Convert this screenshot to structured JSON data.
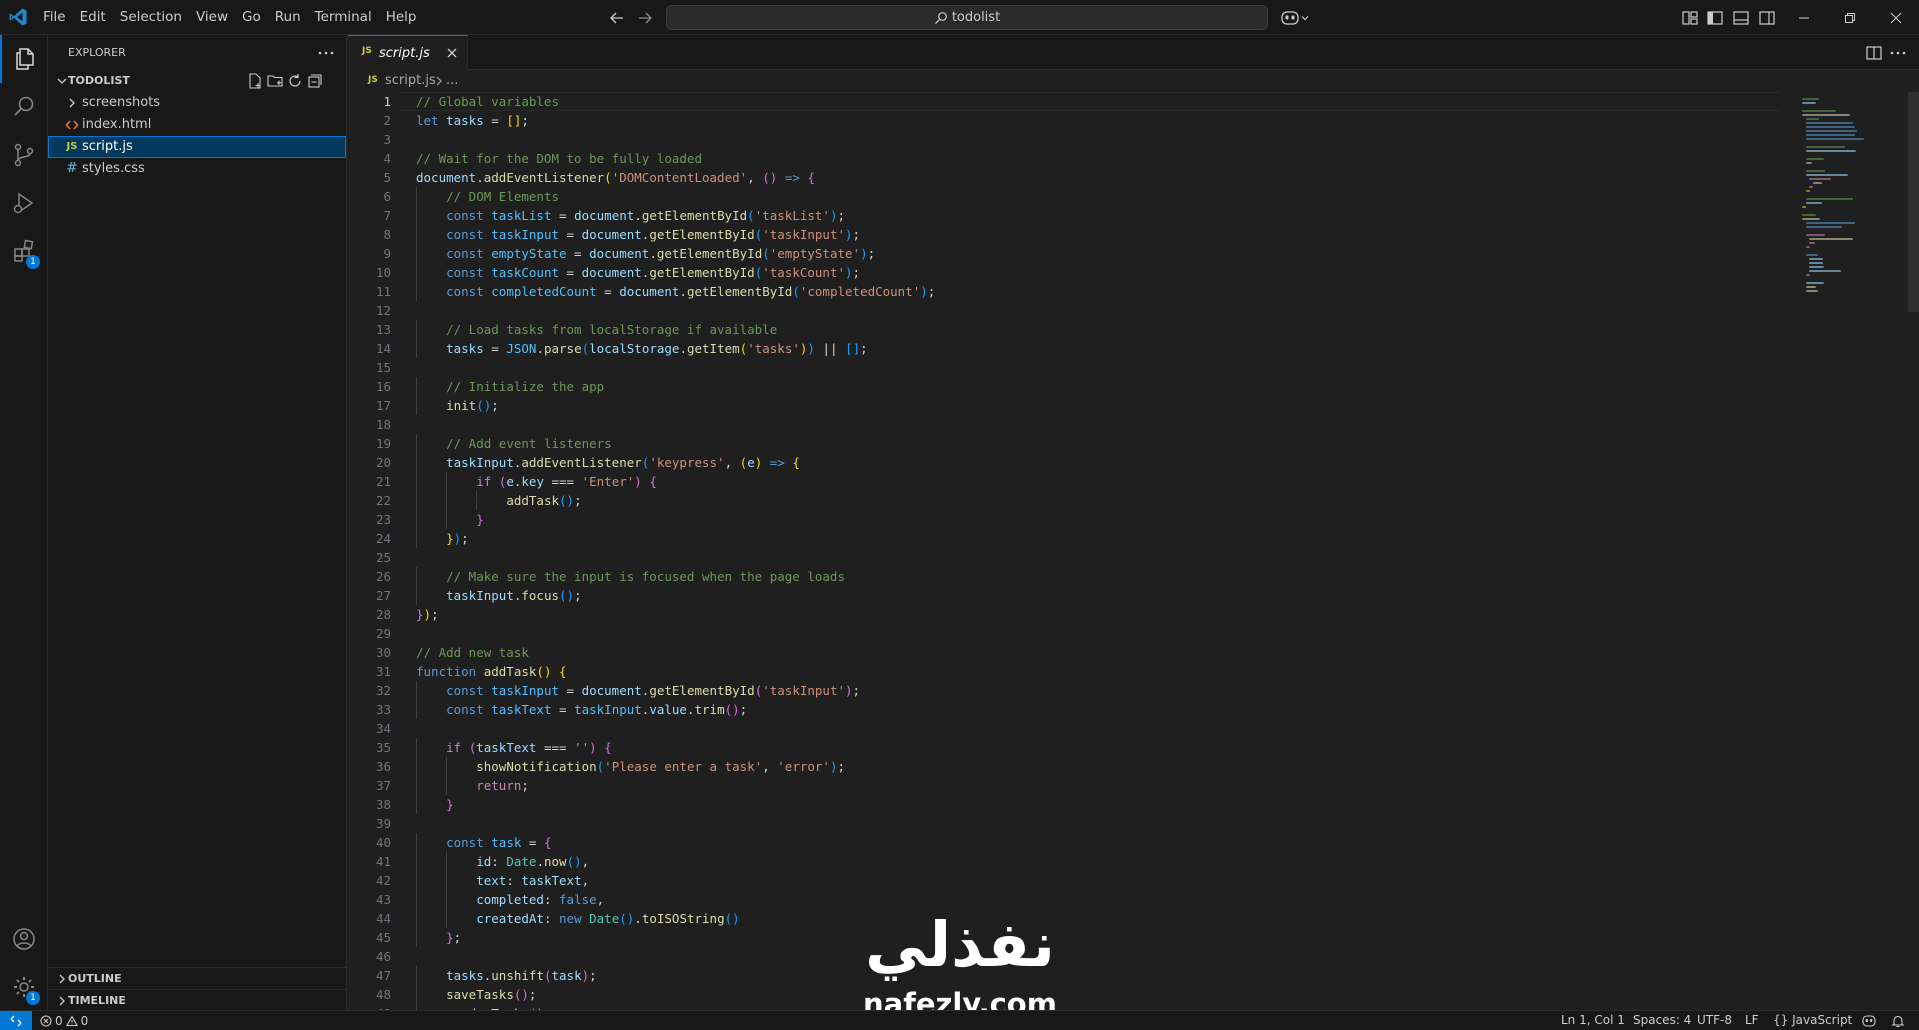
{
  "menu": [
    "File",
    "Edit",
    "Selection",
    "View",
    "Go",
    "Run",
    "Terminal",
    "Help"
  ],
  "search": {
    "text": "todolist"
  },
  "sidebar": {
    "title": "EXPLORER",
    "folder": "TODOLIST",
    "items": [
      {
        "label": "screenshots",
        "kind": "folder"
      },
      {
        "label": "index.html",
        "kind": "html"
      },
      {
        "label": "script.js",
        "kind": "js"
      },
      {
        "label": "styles.css",
        "kind": "css"
      }
    ],
    "icon_text": {
      "js": "JS",
      "css": "#"
    },
    "outline": "OUTLINE",
    "timeline": "TIMELINE"
  },
  "activity": {
    "extensions_badge": "1",
    "manage_badge": "1"
  },
  "tab": {
    "label": "script.js",
    "icon": "JS"
  },
  "breadcrumb": {
    "file": "script.js",
    "more": "..."
  },
  "code": {
    "lines": [
      [
        [
          "c",
          "// Global variables"
        ]
      ],
      [
        [
          "k",
          "let "
        ],
        [
          "v",
          "tasks"
        ],
        [
          "p",
          " = "
        ],
        [
          "b1",
          "[]"
        ],
        [
          "p",
          ";"
        ]
      ],
      [],
      [
        [
          "c",
          "// Wait for the DOM to be fully loaded"
        ]
      ],
      [
        [
          "v",
          "document"
        ],
        [
          "p",
          "."
        ],
        [
          "f",
          "addEventListener"
        ],
        [
          "b1",
          "("
        ],
        [
          "s",
          "'DOMContentLoaded'"
        ],
        [
          "p",
          ", "
        ],
        [
          "b2",
          "()"
        ],
        [
          "k",
          " => "
        ],
        [
          "b2",
          "{"
        ]
      ],
      [
        [
          "p",
          "    "
        ],
        [
          "c",
          "// DOM Elements"
        ]
      ],
      [
        [
          "p",
          "    "
        ],
        [
          "k",
          "const "
        ],
        [
          "vc",
          "taskList"
        ],
        [
          "p",
          " = "
        ],
        [
          "v",
          "document"
        ],
        [
          "p",
          "."
        ],
        [
          "f",
          "getElementById"
        ],
        [
          "b3",
          "("
        ],
        [
          "s",
          "'taskList'"
        ],
        [
          "b3",
          ")"
        ],
        [
          "p",
          ";"
        ]
      ],
      [
        [
          "p",
          "    "
        ],
        [
          "k",
          "const "
        ],
        [
          "vc",
          "taskInput"
        ],
        [
          "p",
          " = "
        ],
        [
          "v",
          "document"
        ],
        [
          "p",
          "."
        ],
        [
          "f",
          "getElementById"
        ],
        [
          "b3",
          "("
        ],
        [
          "s",
          "'taskInput'"
        ],
        [
          "b3",
          ")"
        ],
        [
          "p",
          ";"
        ]
      ],
      [
        [
          "p",
          "    "
        ],
        [
          "k",
          "const "
        ],
        [
          "vc",
          "emptyState"
        ],
        [
          "p",
          " = "
        ],
        [
          "v",
          "document"
        ],
        [
          "p",
          "."
        ],
        [
          "f",
          "getElementById"
        ],
        [
          "b3",
          "("
        ],
        [
          "s",
          "'emptyState'"
        ],
        [
          "b3",
          ")"
        ],
        [
          "p",
          ";"
        ]
      ],
      [
        [
          "p",
          "    "
        ],
        [
          "k",
          "const "
        ],
        [
          "vc",
          "taskCount"
        ],
        [
          "p",
          " = "
        ],
        [
          "v",
          "document"
        ],
        [
          "p",
          "."
        ],
        [
          "f",
          "getElementById"
        ],
        [
          "b3",
          "("
        ],
        [
          "s",
          "'taskCount'"
        ],
        [
          "b3",
          ")"
        ],
        [
          "p",
          ";"
        ]
      ],
      [
        [
          "p",
          "    "
        ],
        [
          "k",
          "const "
        ],
        [
          "vc",
          "completedCount"
        ],
        [
          "p",
          " = "
        ],
        [
          "v",
          "document"
        ],
        [
          "p",
          "."
        ],
        [
          "f",
          "getElementById"
        ],
        [
          "b3",
          "("
        ],
        [
          "s",
          "'completedCount'"
        ],
        [
          "b3",
          ")"
        ],
        [
          "p",
          ";"
        ]
      ],
      [],
      [
        [
          "p",
          "    "
        ],
        [
          "c",
          "// Load tasks from localStorage if available"
        ]
      ],
      [
        [
          "p",
          "    "
        ],
        [
          "v",
          "tasks"
        ],
        [
          "p",
          " = "
        ],
        [
          "vc",
          "JSON"
        ],
        [
          "p",
          "."
        ],
        [
          "f",
          "parse"
        ],
        [
          "b3",
          "("
        ],
        [
          "v",
          "localStorage"
        ],
        [
          "p",
          "."
        ],
        [
          "f",
          "getItem"
        ],
        [
          "b1",
          "("
        ],
        [
          "s",
          "'tasks'"
        ],
        [
          "b1",
          ")"
        ],
        [
          "b3",
          ")"
        ],
        [
          "p",
          " || "
        ],
        [
          "b3",
          "[]"
        ],
        [
          "p",
          ";"
        ]
      ],
      [],
      [
        [
          "p",
          "    "
        ],
        [
          "c",
          "// Initialize the app"
        ]
      ],
      [
        [
          "p",
          "    "
        ],
        [
          "f",
          "init"
        ],
        [
          "b3",
          "()"
        ],
        [
          "p",
          ";"
        ]
      ],
      [],
      [
        [
          "p",
          "    "
        ],
        [
          "c",
          "// Add event listeners"
        ]
      ],
      [
        [
          "p",
          "    "
        ],
        [
          "v",
          "taskInput"
        ],
        [
          "p",
          "."
        ],
        [
          "f",
          "addEventListener"
        ],
        [
          "b3",
          "("
        ],
        [
          "s",
          "'keypress'"
        ],
        [
          "p",
          ", "
        ],
        [
          "b1",
          "("
        ],
        [
          "v",
          "e"
        ],
        [
          "b1",
          ")"
        ],
        [
          "k",
          " => "
        ],
        [
          "b1",
          "{"
        ]
      ],
      [
        [
          "p",
          "        "
        ],
        [
          "kc",
          "if "
        ],
        [
          "b2",
          "("
        ],
        [
          "v",
          "e"
        ],
        [
          "p",
          "."
        ],
        [
          "v",
          "key"
        ],
        [
          "p",
          " === "
        ],
        [
          "s",
          "'Enter'"
        ],
        [
          "b2",
          ")"
        ],
        [
          "p",
          " "
        ],
        [
          "b2",
          "{"
        ]
      ],
      [
        [
          "p",
          "            "
        ],
        [
          "f",
          "addTask"
        ],
        [
          "b3",
          "()"
        ],
        [
          "p",
          ";"
        ]
      ],
      [
        [
          "p",
          "        "
        ],
        [
          "b2",
          "}"
        ]
      ],
      [
        [
          "p",
          "    "
        ],
        [
          "b1",
          "}"
        ],
        [
          "b3",
          ")"
        ],
        [
          "p",
          ";"
        ]
      ],
      [],
      [
        [
          "p",
          "    "
        ],
        [
          "c",
          "// Make sure the input is focused when the page loads"
        ]
      ],
      [
        [
          "p",
          "    "
        ],
        [
          "v",
          "taskInput"
        ],
        [
          "p",
          "."
        ],
        [
          "f",
          "focus"
        ],
        [
          "b3",
          "()"
        ],
        [
          "p",
          ";"
        ]
      ],
      [
        [
          "b2",
          "}"
        ],
        [
          "b1",
          ")"
        ],
        [
          "p",
          ";"
        ]
      ],
      [],
      [
        [
          "c",
          "// Add new task"
        ]
      ],
      [
        [
          "k",
          "function "
        ],
        [
          "f",
          "addTask"
        ],
        [
          "b1",
          "()"
        ],
        [
          "p",
          " "
        ],
        [
          "b1",
          "{"
        ]
      ],
      [
        [
          "p",
          "    "
        ],
        [
          "k",
          "const "
        ],
        [
          "vc",
          "taskInput"
        ],
        [
          "p",
          " = "
        ],
        [
          "v",
          "document"
        ],
        [
          "p",
          "."
        ],
        [
          "f",
          "getElementById"
        ],
        [
          "b2",
          "("
        ],
        [
          "s",
          "'taskInput'"
        ],
        [
          "b2",
          ")"
        ],
        [
          "p",
          ";"
        ]
      ],
      [
        [
          "p",
          "    "
        ],
        [
          "k",
          "const "
        ],
        [
          "vc",
          "taskText"
        ],
        [
          "p",
          " = "
        ],
        [
          "vc",
          "taskInput"
        ],
        [
          "p",
          "."
        ],
        [
          "v",
          "value"
        ],
        [
          "p",
          "."
        ],
        [
          "f",
          "trim"
        ],
        [
          "b2",
          "()"
        ],
        [
          "p",
          ";"
        ]
      ],
      [],
      [
        [
          "p",
          "    "
        ],
        [
          "kc",
          "if "
        ],
        [
          "b2",
          "("
        ],
        [
          "v",
          "taskText"
        ],
        [
          "p",
          " === "
        ],
        [
          "s",
          "''"
        ],
        [
          "b2",
          ")"
        ],
        [
          "p",
          " "
        ],
        [
          "b2",
          "{"
        ]
      ],
      [
        [
          "p",
          "        "
        ],
        [
          "f",
          "showNotification"
        ],
        [
          "b3",
          "("
        ],
        [
          "s",
          "'Please enter a task'"
        ],
        [
          "p",
          ", "
        ],
        [
          "s",
          "'error'"
        ],
        [
          "b3",
          ")"
        ],
        [
          "p",
          ";"
        ]
      ],
      [
        [
          "p",
          "        "
        ],
        [
          "kc",
          "return"
        ],
        [
          "p",
          ";"
        ]
      ],
      [
        [
          "p",
          "    "
        ],
        [
          "b2",
          "}"
        ]
      ],
      [],
      [
        [
          "p",
          "    "
        ],
        [
          "k",
          "const "
        ],
        [
          "vc",
          "task"
        ],
        [
          "p",
          " = "
        ],
        [
          "b2",
          "{"
        ]
      ],
      [
        [
          "p",
          "        "
        ],
        [
          "v",
          "id"
        ],
        [
          "p",
          ": "
        ],
        [
          "t",
          "Date"
        ],
        [
          "p",
          "."
        ],
        [
          "f",
          "now"
        ],
        [
          "b3",
          "()"
        ],
        [
          "p",
          ","
        ]
      ],
      [
        [
          "p",
          "        "
        ],
        [
          "v",
          "text"
        ],
        [
          "p",
          ": "
        ],
        [
          "v",
          "taskText"
        ],
        [
          "p",
          ","
        ]
      ],
      [
        [
          "p",
          "        "
        ],
        [
          "v",
          "completed"
        ],
        [
          "p",
          ": "
        ],
        [
          "k",
          "false"
        ],
        [
          "p",
          ","
        ]
      ],
      [
        [
          "p",
          "        "
        ],
        [
          "v",
          "createdAt"
        ],
        [
          "p",
          ": "
        ],
        [
          "k",
          "new "
        ],
        [
          "t",
          "Date"
        ],
        [
          "b3",
          "()"
        ],
        [
          "p",
          "."
        ],
        [
          "f",
          "toISOString"
        ],
        [
          "b3",
          "()"
        ]
      ],
      [
        [
          "p",
          "    "
        ],
        [
          "b2",
          "}"
        ],
        [
          "p",
          ";"
        ]
      ],
      [],
      [
        [
          "p",
          "    "
        ],
        [
          "v",
          "tasks"
        ],
        [
          "p",
          "."
        ],
        [
          "f",
          "unshift"
        ],
        [
          "b2",
          "("
        ],
        [
          "v",
          "task"
        ],
        [
          "b2",
          ")"
        ],
        [
          "p",
          ";"
        ]
      ],
      [
        [
          "p",
          "    "
        ],
        [
          "f",
          "saveTasks"
        ],
        [
          "b2",
          "()"
        ],
        [
          "p",
          ";"
        ]
      ],
      [
        [
          "p",
          "    "
        ],
        [
          "f",
          "renderTasks"
        ],
        [
          "b2",
          "()"
        ],
        [
          "p",
          ";"
        ]
      ]
    ]
  },
  "watermark": {
    "arabic": "نفذلي",
    "latin": "nafezly.com"
  },
  "status": {
    "errors": "0",
    "warnings": "0",
    "position": "Ln 1, Col 1",
    "spaces": "Spaces: 4",
    "encoding": "UTF-8",
    "eol": "LF",
    "language": "JavaScript"
  },
  "colors": {
    "accent": "#0078d4",
    "background": "#1f1f1f",
    "chrome": "#181818",
    "selection": "#04395e"
  }
}
